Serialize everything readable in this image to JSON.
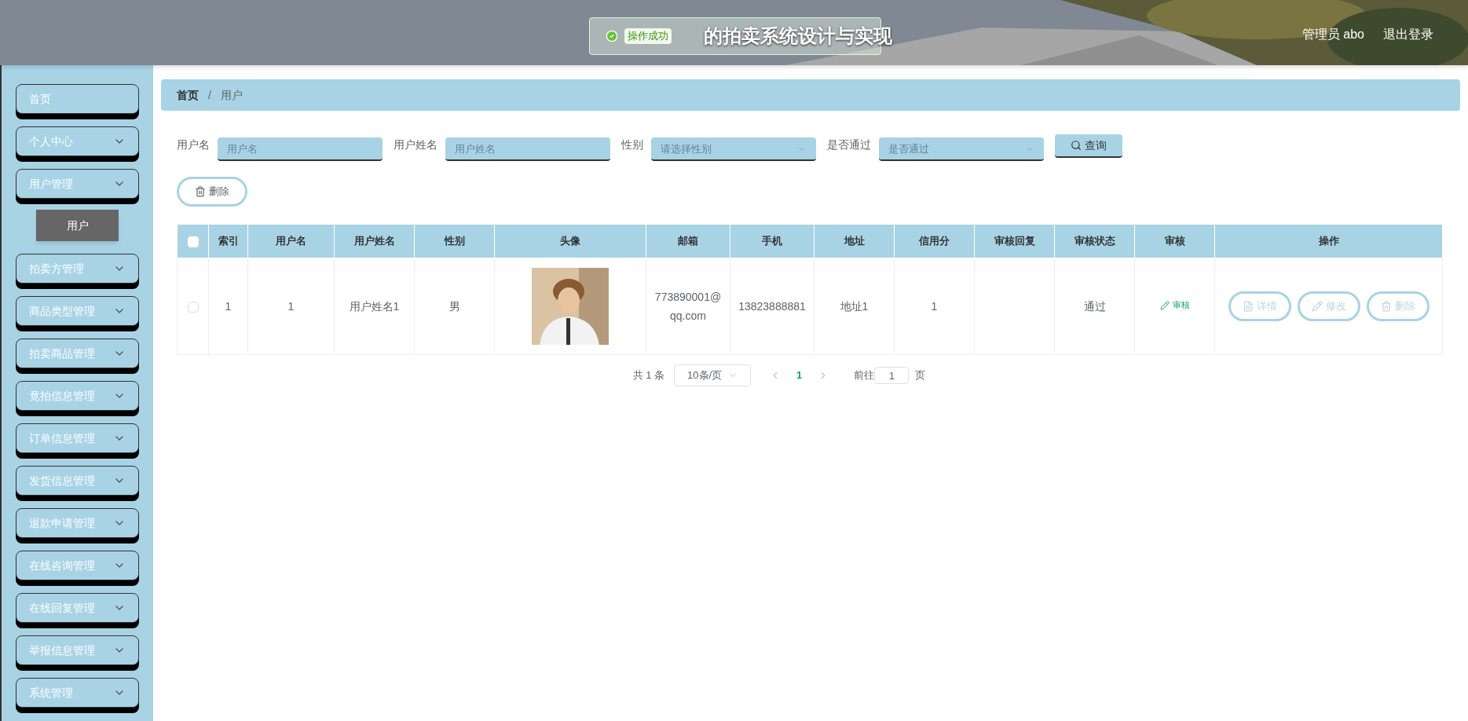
{
  "header": {
    "title": "的拍卖系统设计与实现",
    "user": "管理员 abo",
    "logout": "退出登录"
  },
  "toast": {
    "message": "操作成功"
  },
  "sidebar": {
    "items": [
      {
        "label": "首页",
        "kind": "link"
      },
      {
        "label": "个人中心",
        "kind": "menu"
      },
      {
        "label": "用户管理",
        "kind": "menu",
        "children": [
          {
            "label": "用户",
            "selected": true
          }
        ]
      },
      {
        "label": "拍卖方管理",
        "kind": "menu"
      },
      {
        "label": "商品类型管理",
        "kind": "menu"
      },
      {
        "label": "拍卖商品管理",
        "kind": "menu"
      },
      {
        "label": "竟拍信息管理",
        "kind": "menu"
      },
      {
        "label": "订单信息管理",
        "kind": "menu"
      },
      {
        "label": "发货信息管理",
        "kind": "menu"
      },
      {
        "label": "退款申请管理",
        "kind": "menu"
      },
      {
        "label": "在线咨询管理",
        "kind": "menu"
      },
      {
        "label": "在线回复管理",
        "kind": "menu"
      },
      {
        "label": "举报信息管理",
        "kind": "menu"
      },
      {
        "label": "系统管理",
        "kind": "menu"
      }
    ]
  },
  "breadcrumb": {
    "items": [
      "首页",
      "用户"
    ],
    "separator": "/"
  },
  "filters": [
    {
      "label": "用户名",
      "kind": "input",
      "placeholder": "用户名"
    },
    {
      "label": "用户姓名",
      "kind": "input",
      "placeholder": "用户姓名"
    },
    {
      "label": "性别",
      "kind": "select",
      "placeholder": "请选择性别"
    },
    {
      "label": "是否通过",
      "kind": "select",
      "placeholder": "是否通过"
    }
  ],
  "search_button": "查询",
  "delete_button": "删除",
  "table": {
    "select_all_checked": false,
    "columns": [
      "索引",
      "用户名",
      "用户姓名",
      "性别",
      "头像",
      "邮箱",
      "手机",
      "地址",
      "信用分",
      "审核回复",
      "审核状态",
      "审核",
      "操作"
    ],
    "rows": [
      {
        "checked": false,
        "index": "1",
        "username": "1",
        "name": "用户姓名1",
        "gender": "男",
        "avatar": {
          "kind": "picture"
        },
        "email": "773890001@qq.com",
        "phone": "13823888881",
        "address": "地址1",
        "credit": "1",
        "reply": "",
        "status": "通过",
        "audit": "审核",
        "actions": [
          "详情",
          "修改",
          "删除"
        ]
      }
    ]
  },
  "pagination": {
    "total": "共 1 条",
    "page_size": "10条/页",
    "pages": [
      {
        "label": "1",
        "selected": true
      }
    ],
    "goto": "前往",
    "goto_value": "1",
    "goto_suffix": "页"
  }
}
